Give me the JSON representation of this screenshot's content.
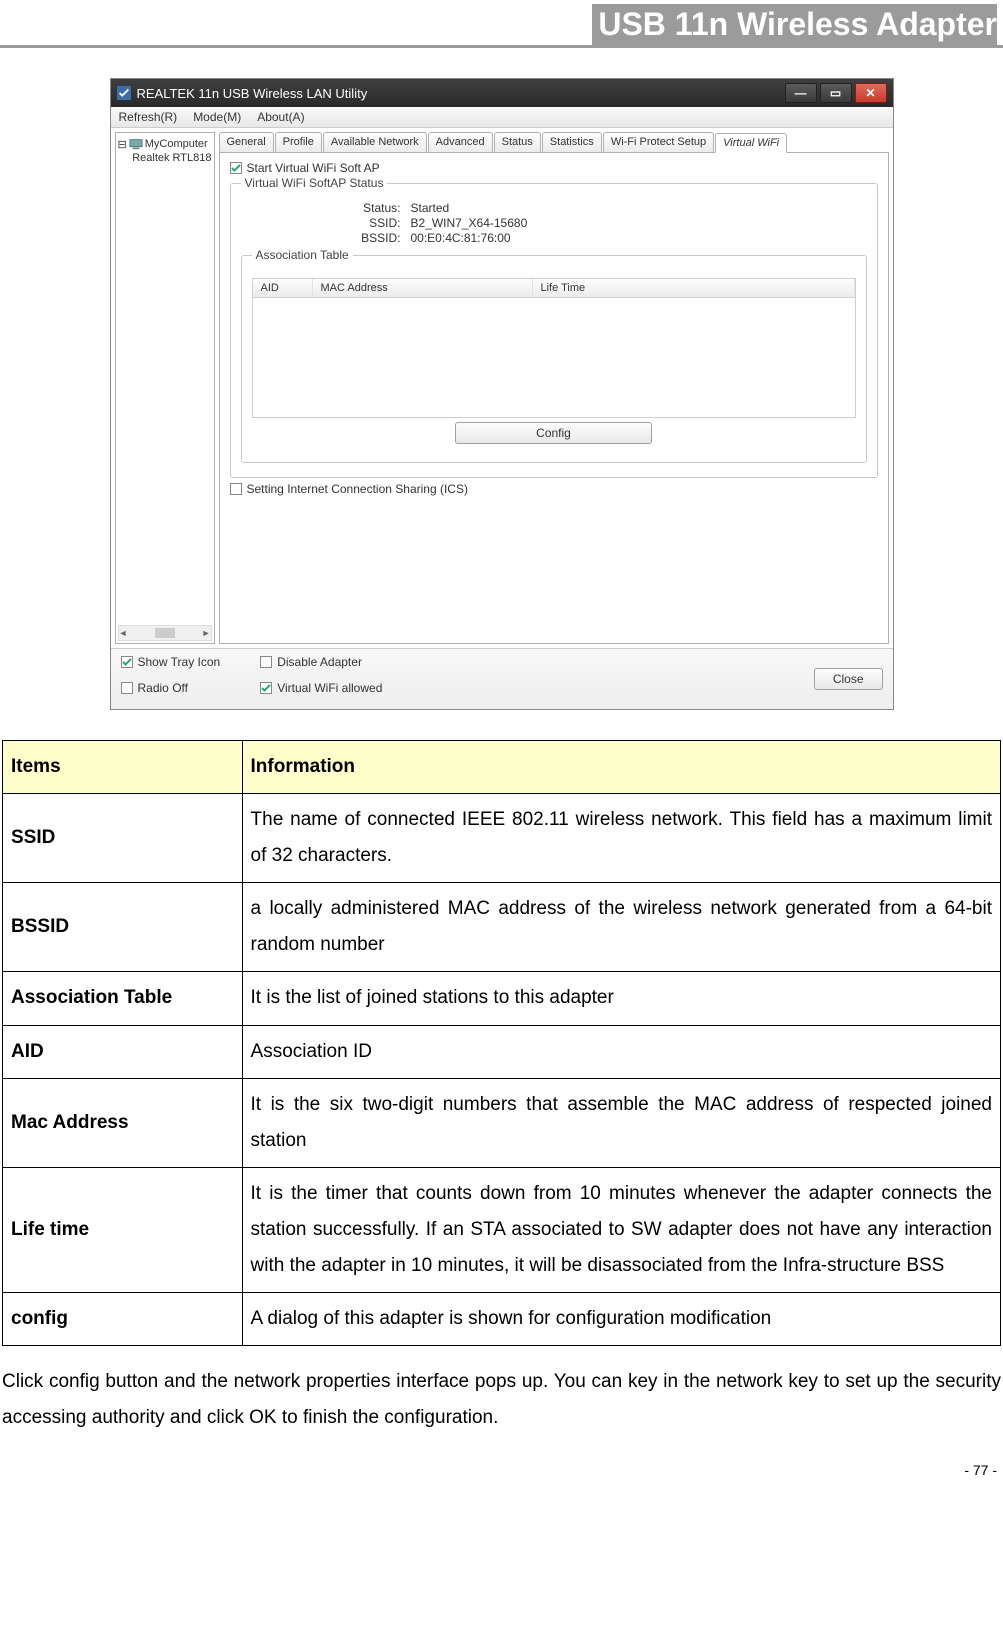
{
  "header": {
    "title": "USB 11n Wireless Adapter"
  },
  "screenshot": {
    "window_title": "REALTEK 11n USB Wireless LAN Utility",
    "menus": [
      "Refresh(R)",
      "Mode(M)",
      "About(A)"
    ],
    "tree": {
      "root": "MyComputer",
      "child": "Realtek RTL818"
    },
    "tabs": [
      "General",
      "Profile",
      "Available Network",
      "Advanced",
      "Status",
      "Statistics",
      "Wi-Fi Protect Setup",
      "Virtual WiFi"
    ],
    "active_tab": "Virtual WiFi",
    "start_ap_label": "Start Virtual WiFi Soft AP",
    "status_legend": "Virtual WiFi SoftAP Status",
    "status": {
      "k1": "Status:",
      "v1": "Started",
      "k2": "SSID:",
      "v2": "B2_WIN7_X64-15680",
      "k3": "BSSID:",
      "v3": "00:E0:4C:81:76:00"
    },
    "assoc_legend": "Association Table",
    "assoc_headers": [
      "AID",
      "MAC Address",
      "Life Time"
    ],
    "config_button": "Config",
    "ics_label": "Setting Internet Connection Sharing (ICS)",
    "bottom": {
      "show_tray": "Show Tray Icon",
      "radio_off": "Radio Off",
      "disable_adapter": "Disable Adapter",
      "vwifi_allowed": "Virtual WiFi allowed",
      "close": "Close"
    }
  },
  "table": {
    "hdr_items": "Items",
    "hdr_info": "Information",
    "rows": [
      {
        "k": "SSID",
        "v": "The name of connected IEEE 802.11 wireless network. This field has a maximum limit of 32 characters."
      },
      {
        "k": "BSSID",
        "v": "a locally administered MAC address of the wireless network generated from a 64-bit random number"
      },
      {
        "k": "Association Table",
        "v": "It is the list of joined stations to this adapter"
      },
      {
        "k": "AID",
        "v": "Association ID"
      },
      {
        "k": "Mac Address",
        "v": "It is the six two-digit numbers that assemble the MAC address of respected joined station"
      },
      {
        "k": "Life time",
        "v": "It is the timer that counts down from 10 minutes whenever the adapter connects the station successfully. If an STA associated to SW adapter does not have any interaction with the adapter in 10 minutes, it will be disassociated from the Infra-structure BSS"
      },
      {
        "k": "config",
        "v": "A dialog of this adapter is shown for configuration modification"
      }
    ]
  },
  "outro": "Click config button and the network properties interface pops up. You can key in the network key to set up the security accessing authority and click OK to finish the configuration.",
  "page_number": "- 77 -"
}
